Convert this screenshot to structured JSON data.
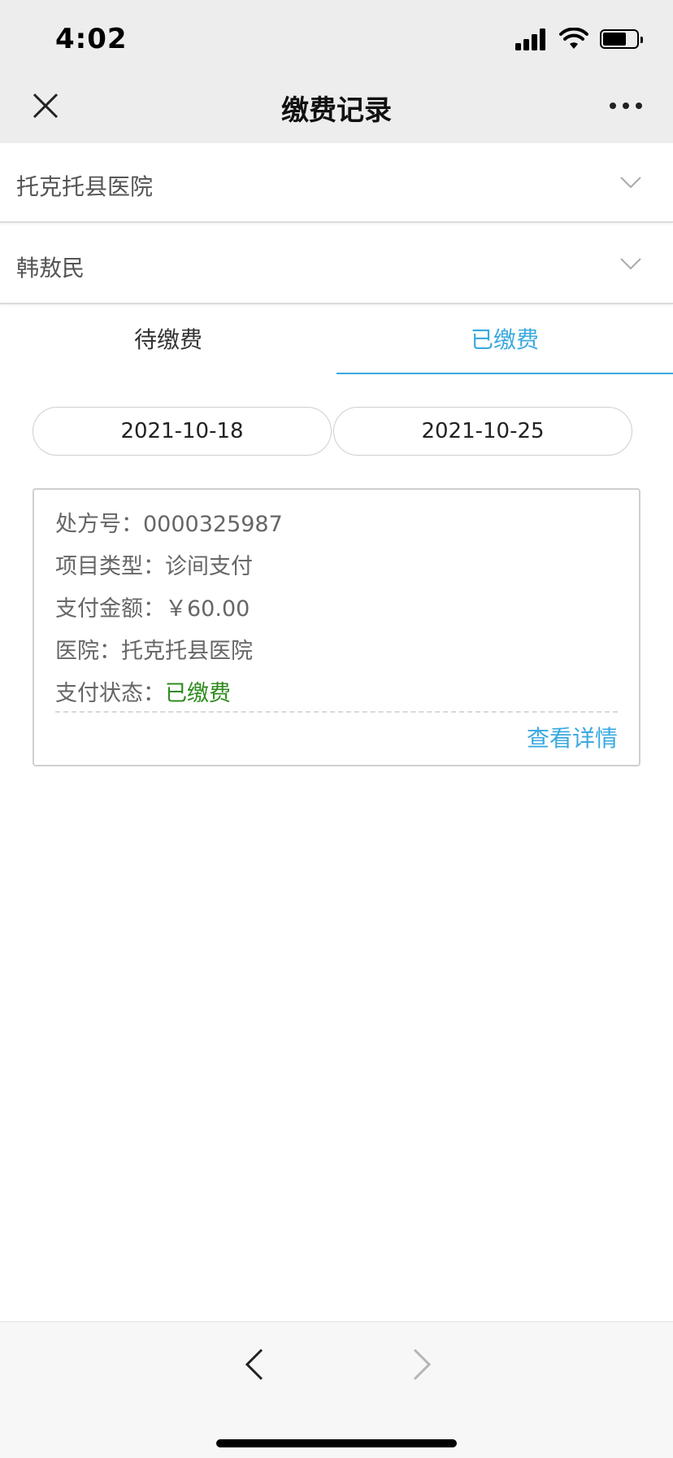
{
  "status_bar": {
    "time": "4:02"
  },
  "nav": {
    "title": "缴费记录"
  },
  "selectors": {
    "hospital": "托克托县医院",
    "patient": "韩敖民"
  },
  "tabs": [
    {
      "label": "待缴费",
      "active": false
    },
    {
      "label": "已缴费",
      "active": true
    }
  ],
  "date_range": {
    "start": "2021-10-18",
    "end": "2021-10-25"
  },
  "record": {
    "prescription_label": "处方号：",
    "prescription_value": "0000325987",
    "type_label": "项目类型：",
    "type_value": "诊间支付",
    "amount_label": "支付金额：",
    "amount_value": "￥60.00",
    "hospital_label": "医院：",
    "hospital_value": "托克托县医院",
    "status_label": "支付状态：",
    "status_value": "已缴费",
    "detail_link": "查看详情"
  },
  "colors": {
    "accent": "#3aa9e0",
    "paid_status": "#2e8b1e",
    "nav_background": "#ededed"
  }
}
